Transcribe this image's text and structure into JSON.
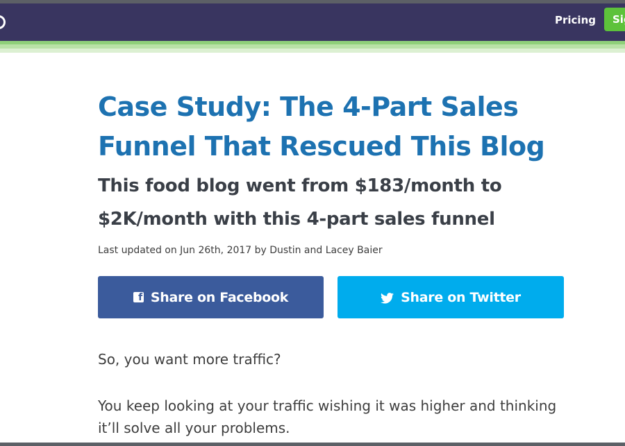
{
  "nav": {
    "pricing_label": "Pricing",
    "signup_label": "Sign Up"
  },
  "article": {
    "title": "Case Study: The 4-Part Sales Funnel That Rescued This Blog",
    "subtitle": "This food blog went from $183/month to $2K/month with this 4-part sales funnel",
    "byline": "Last updated on Jun 26th, 2017 by Dustin and Lacey Baier",
    "share_facebook_label": "Share on Facebook",
    "share_twitter_label": "Share on Twitter",
    "paragraphs": [
      "So, you want more traffic?",
      "You keep looking at your traffic wishing it was higher and thinking it’ll solve all your problems."
    ]
  },
  "icons": {
    "logo": "logo-icon",
    "facebook": "facebook-icon",
    "twitter": "twitter-icon"
  },
  "colors": {
    "navbar": "#393560",
    "title": "#1d72b1",
    "facebook": "#3b5b9c",
    "twitter": "#00aced",
    "signup": "#5dc23b"
  }
}
